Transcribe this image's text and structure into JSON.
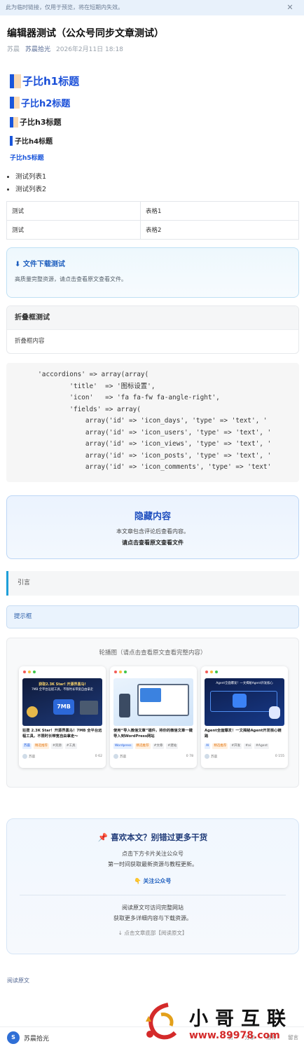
{
  "banner": {
    "text": "此为临时链接，仅用于预览，将在短期内失效。",
    "close": "✕"
  },
  "article": {
    "title": "编辑器测试（公众号同步文章测试）",
    "author": "苏晨",
    "account": "苏晨拾光",
    "date": "2026年2月11日 18:18"
  },
  "headings": {
    "h1": "子比h1标题",
    "h2": "子比h2标题",
    "h3": "子比h3标题",
    "h4": "子比h4标题",
    "h5": "子比h5标题"
  },
  "list_items": [
    "测试列表1",
    "测试列表2"
  ],
  "table": {
    "rows": [
      [
        "测试",
        "表格1"
      ],
      [
        "测试",
        "表格2"
      ]
    ]
  },
  "download": {
    "icon": "⬇",
    "title": "文件下载测试",
    "desc": "高质量完整资源，请点击查看原文查看文件。"
  },
  "fold": {
    "title": "折叠框测试",
    "content": "折叠框内容"
  },
  "code_lines": [
    "        'accordions' => array(array(",
    "                'title'  => '图标设置',",
    "                'icon'   => 'fa fa-fw fa-angle-right',",
    "                'fields' => array(",
    "                    array('id' => 'icon_days', 'type' => 'text', '",
    "                    array('id' => 'icon_users', 'type' => 'text', '",
    "                    array('id' => 'icon_views', 'type' => 'text', '",
    "                    array('id' => 'icon_posts', 'type' => 'text', '",
    "                    array('id' => 'icon_comments', 'type' => 'text'"
  ],
  "hidden": {
    "title": "隐藏内容",
    "line1": "本文章包含评论后查看内容。",
    "line2": "请点击查看原文查看文件"
  },
  "quote": "引言",
  "tip": "提示框",
  "carousel": {
    "title": "轮播图（请点击查看原文查看完整内容）",
    "cards": [
      {
        "thumb_heading": "获取2.3K Star! 开源界黑马!",
        "thumb_sub": "7MB 全平台远程工具，不限时长带宽自由拿走",
        "thumb_badge": "7MB",
        "title": "狂揽 2.3K Star！开源界黑马！7MB 全平台远程工具，不限时长带宽自由拿走～",
        "tags": [
          "苏晨",
          "精选推荐",
          "#资源",
          "#工具"
        ],
        "author": "苏晨",
        "stats": "0 62"
      },
      {
        "thumb_heading": "",
        "thumb_sub": "",
        "thumb_badge": "",
        "title": "使用“导入微信文章”插件，将你的微信文章一键导入到WordPress网站",
        "tags": [
          "Wordpress",
          "精选推荐",
          "#文章",
          "#建站"
        ],
        "author": "苏晨",
        "stats": "0 78"
      },
      {
        "thumb_heading": "Agent全面爆发！一文揭秘Agent开发核心",
        "thumb_sub": "",
        "thumb_badge": "",
        "title": "Agent全面爆发！一文揭秘Agent开发核心链路",
        "tags": [
          "AI",
          "精选推荐",
          "#开发",
          "#ai",
          "#Agent"
        ],
        "author": "苏晨",
        "stats": "0 155"
      }
    ]
  },
  "follow": {
    "pin": "📌",
    "title": "喜欢本文？别错过更多干货",
    "line1": "点击下方卡片关注公众号",
    "line2": "第一时间获取最新资源与教程更新。",
    "button": "👇 关注公众号",
    "line3": "阅读原文可访问完整网站",
    "line4": "获取更多详细内容与下载资源。",
    "line5": "↓ 点击文章底部【阅读原文】"
  },
  "read_original": "阅读原文",
  "bottom_bar": {
    "account": "苏晨拾光",
    "actions": [
      "赞",
      "分享",
      "推荐",
      "留言"
    ]
  },
  "watermark": {
    "text": "小哥互联",
    "url": "www.89978.com"
  },
  "colors": {
    "accent": "#1a56db",
    "link": "#576b95",
    "quote_bar": "#1e9fd9"
  }
}
